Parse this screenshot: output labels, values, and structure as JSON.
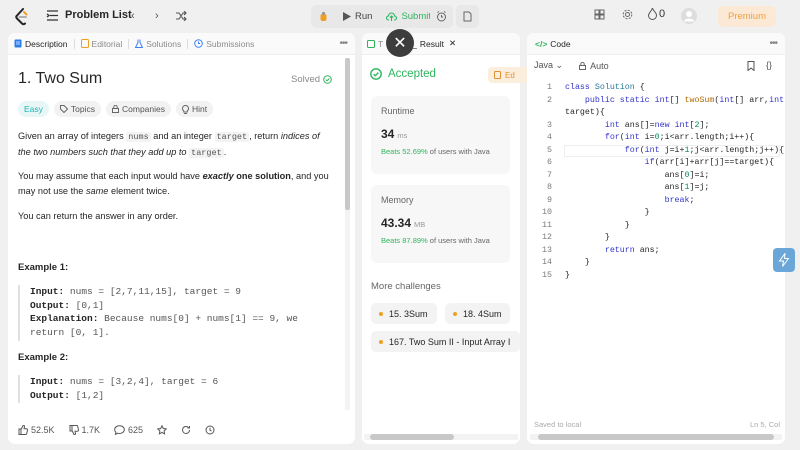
{
  "header": {
    "title": "Problem List",
    "run_label": "Run",
    "submit_label": "Submit",
    "streak_count": "0",
    "premium_label": "Premium"
  },
  "description_panel": {
    "tabs": [
      {
        "label": "Description"
      },
      {
        "label": "Editorial"
      },
      {
        "label": "Solutions"
      },
      {
        "label": "Submissions"
      }
    ],
    "problem_title": "1. Two Sum",
    "status": "Solved",
    "chips": {
      "difficulty": "Easy",
      "topics": "Topics",
      "companies": "Companies",
      "hint": "Hint"
    },
    "para1": {
      "a": "Given an array of integers ",
      "c1": "nums",
      "b": " and an integer ",
      "c2": "target",
      "c": ", return ",
      "d": "indices of the two numbers such that they add up to",
      "e": " ",
      "c3": "target",
      "f": "."
    },
    "para2": {
      "a": "You may assume that each input would have ",
      "b": "exactly",
      "c": " one solution",
      "d": ", and you may not use the ",
      "e": "same",
      "f": " element twice."
    },
    "para3": "You can return the answer in any order.",
    "example1": {
      "heading": "Example 1:",
      "input_label": "Input:",
      "input_value": "nums = [2,7,11,15], target = 9",
      "output_label": "Output:",
      "output_value": "[0,1]",
      "explanation_label": "Explanation:",
      "explanation_value": "Because nums[0] + nums[1] == 9, we return [0, 1]."
    },
    "example2": {
      "heading": "Example 2:",
      "input_label": "Input:",
      "input_value": "nums = [3,2,4], target = 6",
      "output_label": "Output:",
      "output_value": "[1,2]"
    },
    "footer": {
      "likes": "52.5K",
      "dislikes": "1.7K",
      "comments": "625"
    }
  },
  "result_panel": {
    "tabs": [
      {
        "label": "T"
      },
      {
        "label": "Result"
      }
    ],
    "status": "Accepted",
    "editorial_button": "Ed",
    "runtime": {
      "label": "Runtime",
      "value": "34",
      "unit": "ms",
      "beats_pct": "Beats 52.69%",
      "beats_suffix": " of users with Java"
    },
    "memory": {
      "label": "Memory",
      "value": "43.34",
      "unit": "MB",
      "beats_pct": "Beats 87.89%",
      "beats_suffix": " of users with Java"
    },
    "more_challenges_label": "More challenges",
    "challenges": [
      {
        "label": "15. 3Sum"
      },
      {
        "label": "18. 4Sum"
      },
      {
        "label": "167. Two Sum II - Input Array I"
      }
    ]
  },
  "code_panel": {
    "tab_label": "Code",
    "language": "Java",
    "mode": "Auto",
    "saved_label": "Saved to local",
    "cursor_pos": "Ln 5, Col",
    "lines": [
      {
        "n": "1",
        "t": "class Solution {"
      },
      {
        "n": "2",
        "t": "    public static int[] twoSum(int[] arr,int"
      },
      {
        "n": "",
        "t": "target){"
      },
      {
        "n": "3",
        "t": "        int ans[]=new int[2];"
      },
      {
        "n": "4",
        "t": "        for(int i=0;i<arr.length;i++){"
      },
      {
        "n": "5",
        "t": "            for(int j=i+1;j<arr.length;j++){"
      },
      {
        "n": "6",
        "t": "                if(arr[i]+arr[j]==target){"
      },
      {
        "n": "7",
        "t": "                    ans[0]=i;"
      },
      {
        "n": "8",
        "t": "                    ans[1]=j;"
      },
      {
        "n": "9",
        "t": "                    break;"
      },
      {
        "n": "10",
        "t": "                }"
      },
      {
        "n": "11",
        "t": "            }"
      },
      {
        "n": "12",
        "t": "        }"
      },
      {
        "n": "13",
        "t": "        return ans;"
      },
      {
        "n": "14",
        "t": "    }"
      },
      {
        "n": "15",
        "t": "}"
      }
    ]
  },
  "colors": {
    "accent_green": "#2db55d",
    "premium_orange": "#f0a040",
    "easy_teal": "#1cb8b8"
  }
}
